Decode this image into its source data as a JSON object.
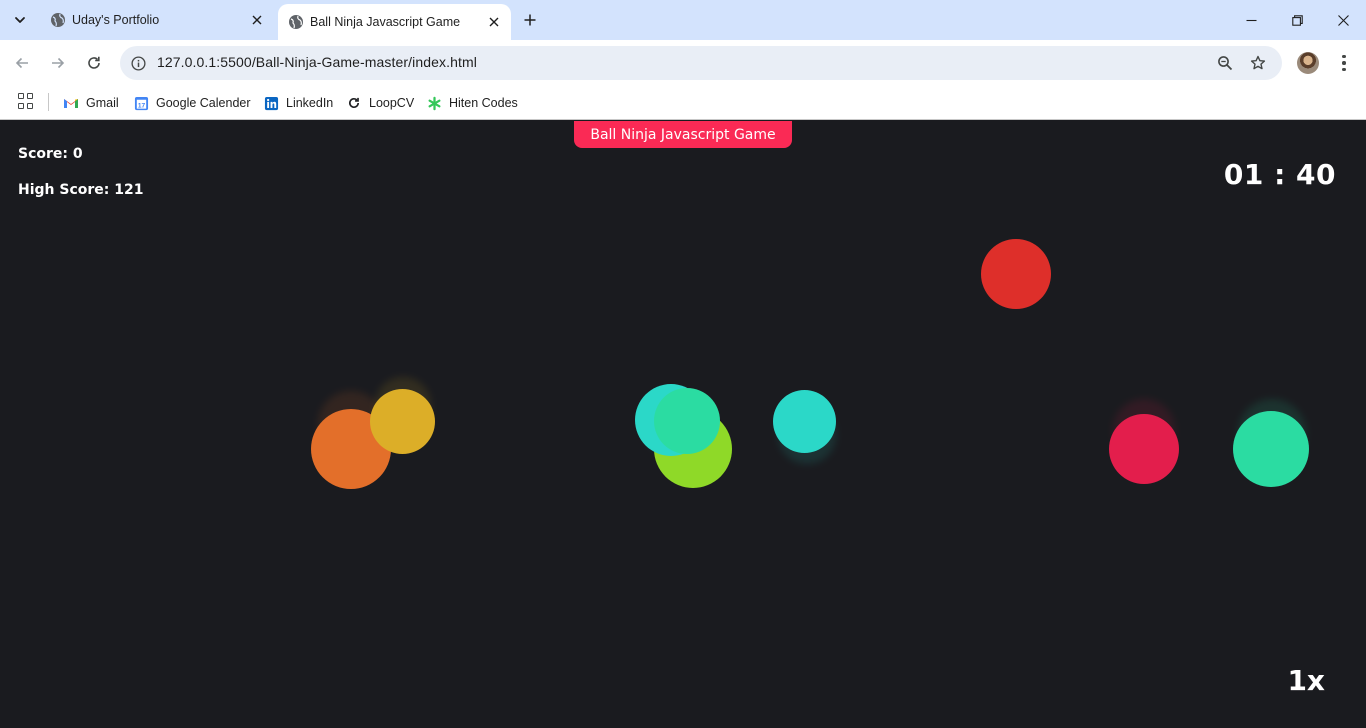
{
  "browser": {
    "tabs": [
      {
        "title": "Uday's Portfolio",
        "active": false
      },
      {
        "title": "Ball Ninja Javascript Game",
        "active": true
      }
    ],
    "url": "127.0.0.1:5500/Ball-Ninja-Game-master/index.html",
    "bookmarks": [
      {
        "label": "Gmail",
        "icon": "gmail-icon"
      },
      {
        "label": "Google Calender",
        "icon": "calendar-icon"
      },
      {
        "label": "LinkedIn",
        "icon": "linkedin-icon"
      },
      {
        "label": "LoopCV",
        "icon": "loopcv-icon"
      },
      {
        "label": "Hiten Codes",
        "icon": "hiten-codes-icon"
      }
    ]
  },
  "game": {
    "title": "Ball Ninja Javascript Game",
    "score_text": "Score: 0",
    "high_score_text": "High Score: 121",
    "timer": "01 : 40",
    "multiplier": "1x",
    "ball_colors": {
      "orange": "#e36f2a",
      "yellow": "#dcae28",
      "cyan": "#2bd8c8",
      "green": "#2bdca2",
      "lime": "#8fd928",
      "red": "#de2f2a",
      "crimson": "#e31e4c",
      "accent": "#fa2a55"
    }
  }
}
